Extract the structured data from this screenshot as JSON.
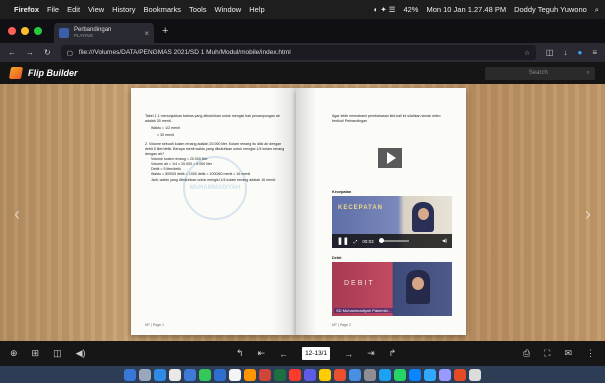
{
  "menubar": {
    "app": "Firefox",
    "items": [
      "File",
      "Edit",
      "View",
      "History",
      "Bookmarks",
      "Tools",
      "Window",
      "Help"
    ],
    "battery": "42%",
    "datetime": "Mon 10 Jan  1.27.48 PM",
    "user": "Doddy Teguh Yuwono"
  },
  "tab": {
    "title": "Perbandingan",
    "subtitle": "PLAYING",
    "close": "×"
  },
  "nav": {
    "url": "file:///Volumes/DATA/PENGMAS 2021/SD 1 Muh/Modul/mobile/index.html"
  },
  "flipbuilder": {
    "logo": "Flip Builder",
    "search_placeholder": "Search"
  },
  "left_page": {
    "lines": [
      "Tabel 1.1 menunjukkan bahwa yang dibutuhkan untuk mengisi bak penampungan air adalah 30 menit.",
      "Waktu = 1/2 menit",
      "= 30 menit",
      "2. Volume sebuah kolam renang adalah 20.000 liter. Kolam renang itu diisi air dengan debit 5 liter/detik. Berapa menit waktu yang dibutuhkan untuk mengisi 1/4 kolam renang dengan air?",
      "Volume kolam renang = 20.000 liter",
      "Volume air = 1/4 × 20.000 = 5.000 liter",
      "Debit = 5 liter/detik",
      "Waktu = 5000/5 detik = 1000 detik = 1000/60 menit = 16 menit",
      "Jadi, waktu yang dibutuhkan untuk mengisi 1/4 kolam renang adalah 16 menit."
    ],
    "watermark": "MUHAMMADIYAH",
    "footer": "MT | Page 1"
  },
  "right_page": {
    "intro": "Agar lebih memahami pembahasan kita kali ini silahkan simak video berikut! Perbandingan",
    "kecepatan_label": "Kecepatan",
    "video1_title": "KECEPATAN",
    "video1_time": "00:03",
    "debit_label": "Debit",
    "video2_title": "DEBIT",
    "video2_caption": "SD Muhammadiyah Pakembi...",
    "footer": "MT | Page 2"
  },
  "toolbar": {
    "page_value": "12-13/1"
  },
  "colors": {
    "dock": "#2d3d55",
    "dot_red": "#ff5f57",
    "dot_yellow": "#febc2e",
    "dot_green": "#28c840"
  }
}
